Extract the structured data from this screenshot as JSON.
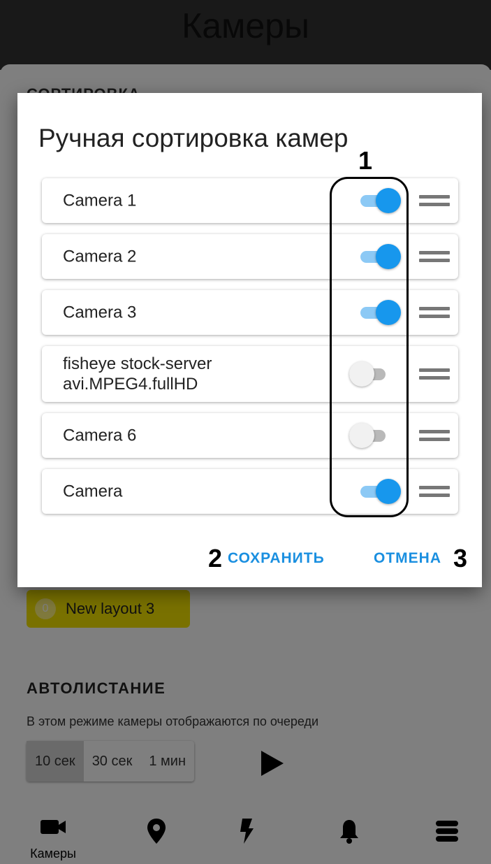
{
  "header": {
    "title": "Камеры"
  },
  "background": {
    "section_peek": "СОРТИРОВКА",
    "layout_chip": {
      "count": "0",
      "name": "New layout 3"
    },
    "autoscroll": {
      "title": "АВТОЛИСТАНИЕ",
      "description": "В этом режиме камеры отображаются по очереди",
      "intervals": [
        "10 сек",
        "30 сек",
        "1 мин"
      ],
      "selected_interval": "10 сек"
    }
  },
  "bottom_nav": {
    "items": [
      {
        "label": "Камеры",
        "icon": "video-camera-icon"
      },
      {
        "label": "",
        "icon": "map-pin-icon"
      },
      {
        "label": "",
        "icon": "lightning-icon"
      },
      {
        "label": "",
        "icon": "bell-icon"
      },
      {
        "label": "",
        "icon": "server-icon"
      }
    ]
  },
  "dialog": {
    "title": "Ручная сортировка камер",
    "cameras": [
      {
        "name": "Camera 1",
        "enabled": true
      },
      {
        "name": "Camera 2",
        "enabled": true
      },
      {
        "name": "Camera 3",
        "enabled": true
      },
      {
        "name": "fisheye stock-server\navi.MPEG4.fullHD",
        "enabled": false
      },
      {
        "name": "Camera 6",
        "enabled": false
      },
      {
        "name": "Camera",
        "enabled": true
      }
    ],
    "save_label": "СОХРАНИТЬ",
    "cancel_label": "ОТМЕНА"
  },
  "annotations": {
    "toggles": "1",
    "save": "2",
    "cancel": "3"
  },
  "colors": {
    "accent": "#1797ed",
    "toggle_track_on": "#8cc9f5",
    "chip": "#f2e200",
    "header": "#333333"
  }
}
